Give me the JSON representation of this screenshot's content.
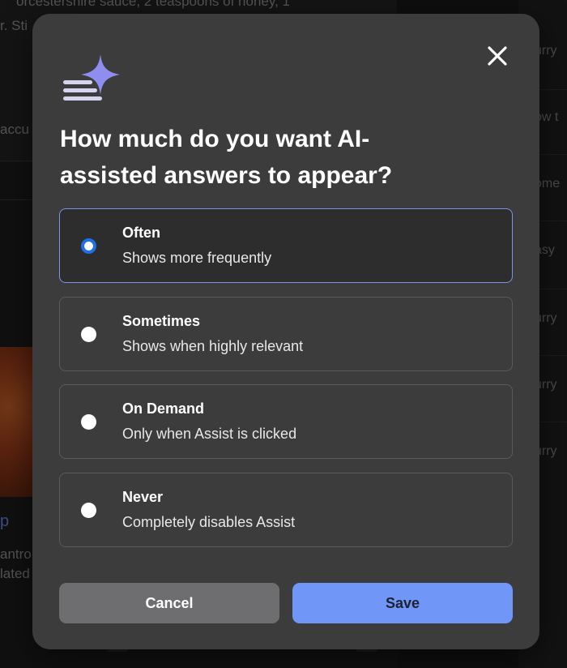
{
  "background": {
    "left_text": [
      "orcestershire sauce, 2 teaspoons of honey, 1",
      "r. Sti",
      "accu",
      "p",
      "antro,",
      "lated"
    ],
    "right_items": [
      "urry",
      "ow t",
      "ome",
      "asy",
      "urry",
      "urry",
      "urry"
    ]
  },
  "modal": {
    "title": "How much do you want AI-assisted answers to appear?",
    "close_icon": "close-icon",
    "logo_icon": "ai-sparkle-icon",
    "options": [
      {
        "title": "Often",
        "description": "Shows more frequently",
        "selected": true
      },
      {
        "title": "Sometimes",
        "description": "Shows when highly relevant",
        "selected": false
      },
      {
        "title": "On Demand",
        "description": "Only when Assist is clicked",
        "selected": false
      },
      {
        "title": "Never",
        "description": "Completely disables Assist",
        "selected": false
      }
    ],
    "cancel_label": "Cancel",
    "save_label": "Save"
  },
  "colors": {
    "accent": "#7097f8",
    "radio_selected": "#1f6fe8",
    "modal_bg": "#3c3c3d"
  }
}
